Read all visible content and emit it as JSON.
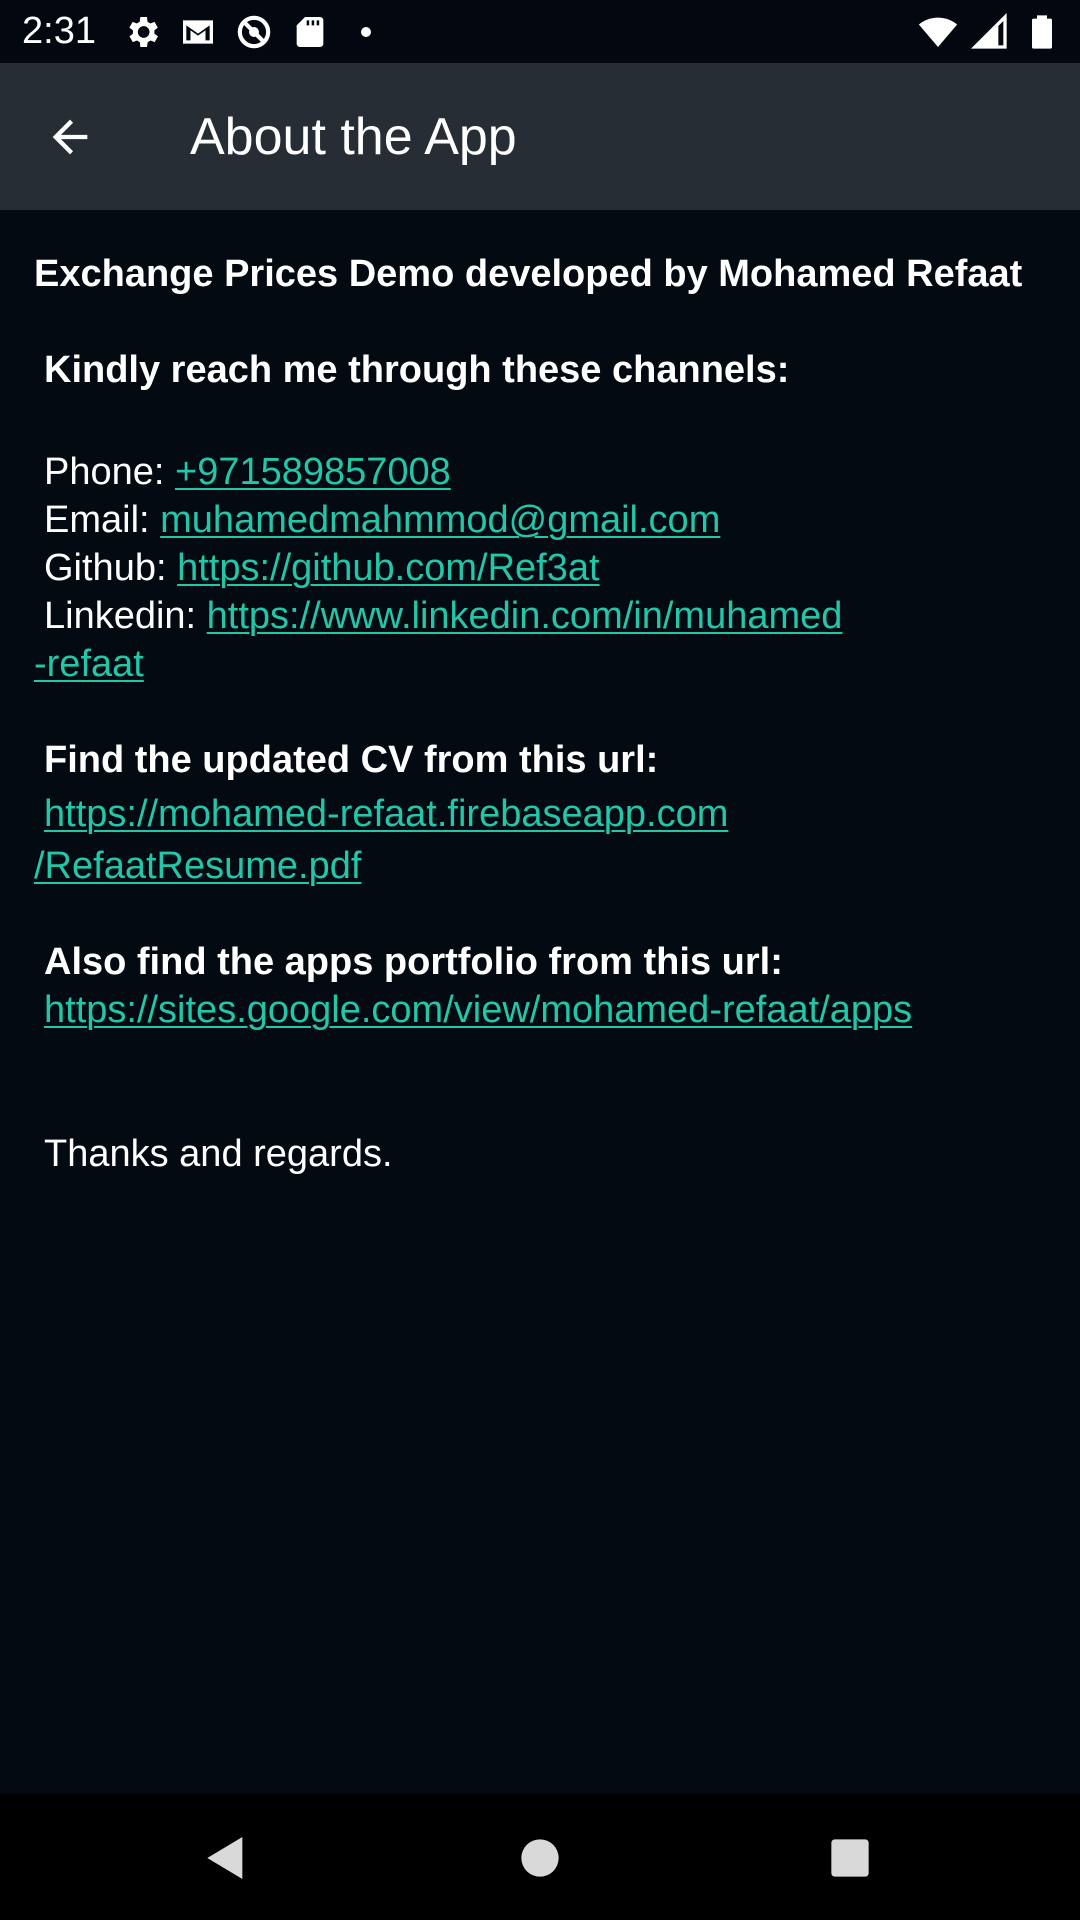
{
  "status_bar": {
    "time": "2:31",
    "left_icons": [
      "settings-icon",
      "gmail-icon",
      "data-saver-icon",
      "sd-card-icon",
      "dot-icon"
    ],
    "right_icons": [
      "wifi-icon",
      "cellular-icon",
      "battery-icon"
    ]
  },
  "app_bar": {
    "title": "About the App",
    "back_icon": "arrow-back-icon"
  },
  "content": {
    "intro": "Exchange Prices Demo developed by Mohamed Refaat",
    "reach_heading": "Kindly reach me through these channels:",
    "contacts": [
      {
        "label": "Phone: ",
        "value": "+971589857008"
      },
      {
        "label": "Email: ",
        "value": "muhamedmahmmod@gmail.com"
      },
      {
        "label": "Github: ",
        "value": "https://github.com/Ref3at"
      },
      {
        "label": "Linkedin: ",
        "value_line1": "https://www.linkedin.com/in/muhamed",
        "value_line2": "-refaat"
      }
    ],
    "cv_heading": "Find the updated CV from this url:",
    "cv_link_line1": "https://mohamed-refaat.firebaseapp.com",
    "cv_link_line2": "/RefaatResume.pdf",
    "portfolio_heading": "Also find the apps portfolio from this url:",
    "portfolio_link": "https://sites.google.com/view/mohamed-refaat/apps",
    "closing": "Thanks and regards."
  },
  "colors": {
    "background": "#040a12",
    "app_bar": "#262d35",
    "link": "#22c6a8",
    "text": "#ffffff"
  },
  "nav_bar": {
    "buttons": [
      "back-triangle-icon",
      "home-circle-icon",
      "recents-square-icon"
    ]
  }
}
